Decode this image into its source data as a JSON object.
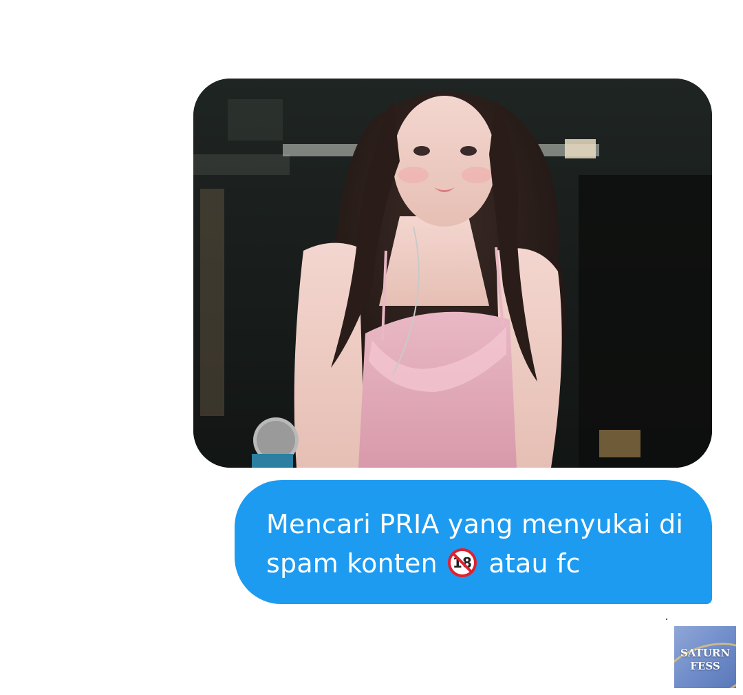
{
  "message": {
    "line1": "Mencari PRIA yang menyukai di",
    "line2_before": "spam konten",
    "line2_emoji": "no-under-18-icon",
    "line2_after": "atau fc",
    "bubble_color": "#1d9bf0",
    "text_color": "#ffffff"
  },
  "photo": {
    "subject": "photo-attachment"
  },
  "watermark": {
    "line1": "SATURN",
    "line2": "FESS"
  }
}
